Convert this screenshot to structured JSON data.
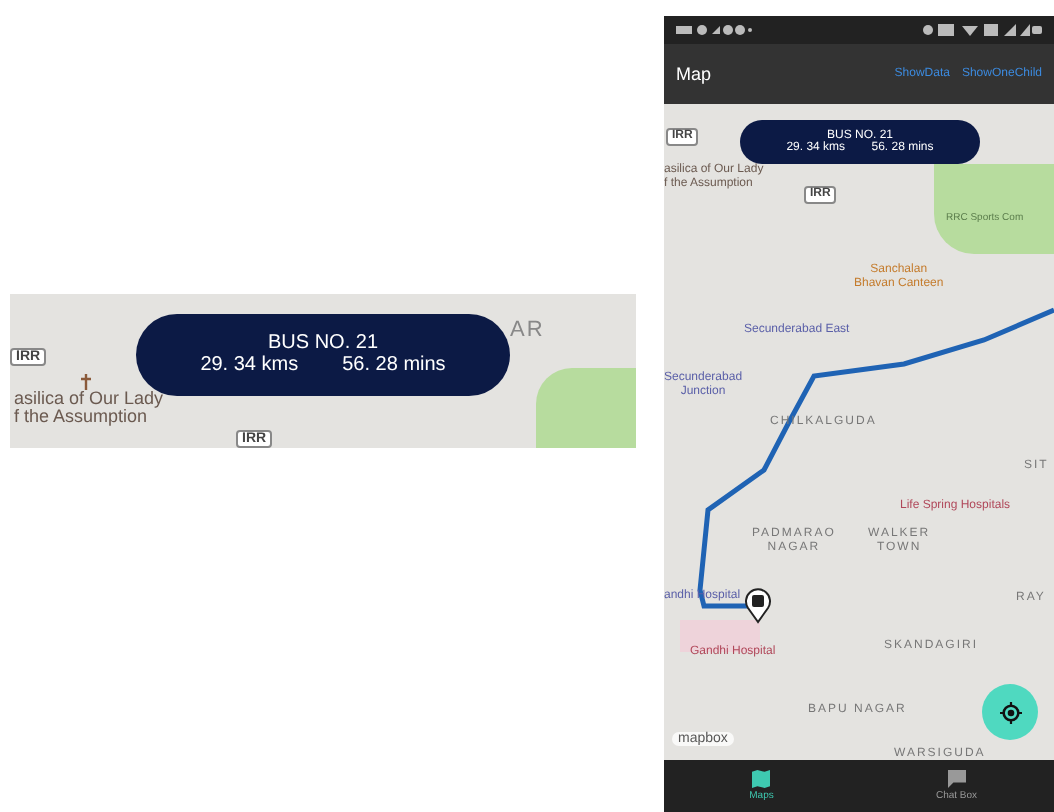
{
  "detail_view": {
    "bus_card": {
      "title": "BUS NO.  21",
      "distance": "29. 34 kms",
      "duration": "56. 28 mins"
    },
    "map_labels": [
      {
        "text": "IRR",
        "kind": "road"
      },
      {
        "text": "asilica of Our Lady\nf the Assumption",
        "kind": "place"
      },
      {
        "text": "IRR",
        "kind": "road"
      },
      {
        "text": "AR",
        "kind": "area"
      }
    ]
  },
  "phone": {
    "app_bar": {
      "title": "Map",
      "actions": [
        "ShowData",
        "ShowOneChild"
      ]
    },
    "bus_card": {
      "title": "BUS NO.  21",
      "distance": "29. 34 kms",
      "duration": "56. 28 mins"
    },
    "map_labels": [
      {
        "text": "IRR",
        "kind": "road"
      },
      {
        "text": "asilica of Our Lady\nf the Assumption",
        "kind": "place"
      },
      {
        "text": "IRR",
        "kind": "road"
      },
      {
        "text": "RRC Sports Com",
        "kind": "park"
      },
      {
        "text": "Sanchalan\nBhavan Canteen",
        "kind": "food"
      },
      {
        "text": "Secunderabad East",
        "kind": "transit"
      },
      {
        "text": "Secunderabad\nJunction",
        "kind": "transit"
      },
      {
        "text": "CHILKALGUDA",
        "kind": "area"
      },
      {
        "text": "SIT",
        "kind": "area"
      },
      {
        "text": "Life Spring Hospitals",
        "kind": "hospital"
      },
      {
        "text": "PADMARAO\nNAGAR",
        "kind": "area"
      },
      {
        "text": "WALKER\nTOWN",
        "kind": "area"
      },
      {
        "text": "andhi Hospital",
        "kind": "transit"
      },
      {
        "text": "Gandhi Hospital",
        "kind": "hospital"
      },
      {
        "text": "SKANDAGIRI",
        "kind": "area"
      },
      {
        "text": "RAY",
        "kind": "area"
      },
      {
        "text": "BAPU NAGAR",
        "kind": "area"
      },
      {
        "text": "WARSIGUDA",
        "kind": "area"
      }
    ],
    "attribution": "mapbox",
    "nav": [
      {
        "label": "Maps",
        "selected": true
      },
      {
        "label": "Chat Box",
        "selected": false
      }
    ]
  }
}
